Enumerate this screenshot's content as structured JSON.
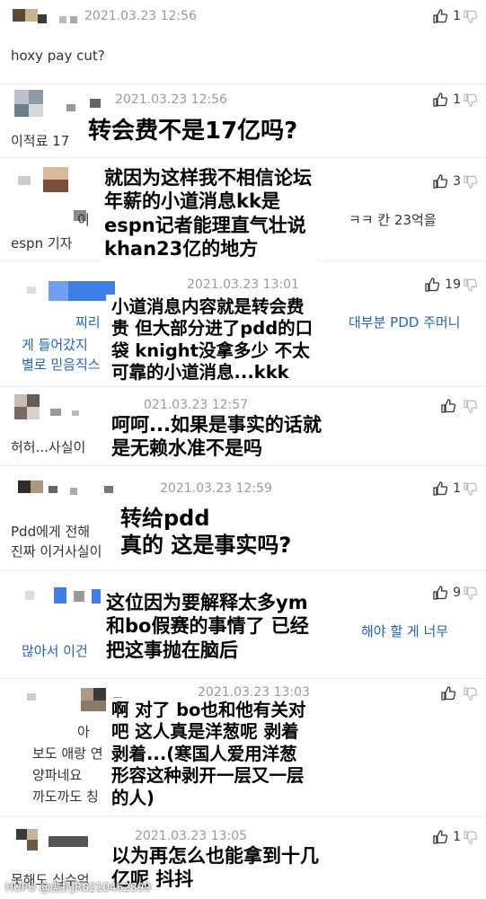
{
  "comments": [
    {
      "date": "2021.03.23 12:56",
      "likes": "1",
      "body": "hoxy pay cut?"
    },
    {
      "date": "2021.03.23 12:56",
      "likes": "1",
      "body": "이적료 17"
    },
    {
      "date": "",
      "likes": "3",
      "body_1": "이",
      "body_1b": "ㅋㅋ 칸 23억을",
      "body_2": "espn 기자"
    },
    {
      "date": "2021.03.23 13:01",
      "likes": "19",
      "body_1": "찌리",
      "body_1b": "대부분 PDD 주머니",
      "body_2": "게 들어갔지",
      "body_3": "별로 믿음직스"
    },
    {
      "date": "021.03.23 12:57",
      "likes": "",
      "body": "허허...사실이"
    },
    {
      "date": "2021.03.23 12:59",
      "likes": "1",
      "body_1": "Pdd에게 전해",
      "body_2": "진짜 이거사실이"
    },
    {
      "date": "",
      "likes": "9",
      "body_1": "해야 할 게 너무",
      "body_2": "많아서 이건"
    },
    {
      "date": "2021.03.23 13:03",
      "likes": "",
      "body_1": "아 ",
      "body_2": "보도 애랑 연",
      "body_3": "양파네요",
      "body_4": "까도까도 칭"
    },
    {
      "date": "2021.03.23 13:05",
      "likes": "1",
      "body": "못해도 십수억"
    }
  ],
  "overlays": [
    "转会费不是17亿吗?",
    "就因为这样我不相信论坛\n年薪的小道消息kk是\nespn记者能理直气壮说\nkhan23亿的地方",
    "小道消息内容就是转会费\n贵 但大部分进了pdd的口\n袋 knight没拿多少 不太\n可靠的小道消息...kkk",
    "呵呵...如果是事实的话就\n是无赖水准不是吗",
    "转给pdd\n真的 这是事实吗?",
    "这位因为要解释太多ym\n和bo假赛的事情了 已经\n把这事抛在脑后",
    "啊 对了 bo也和他有关对\n吧 这人真是洋葱呢 剥着\n剥着...(寒国人爱用洋葱\n形容这种剥开一层又一层\n的人)",
    "以为再怎么也能拿到十几\n亿呢 抖抖"
  ],
  "watermark": "HUPU @虎扑JR0210462899",
  "icons": {
    "like": "thumbs-up-icon",
    "dislike": "thumbs-down-icon"
  }
}
